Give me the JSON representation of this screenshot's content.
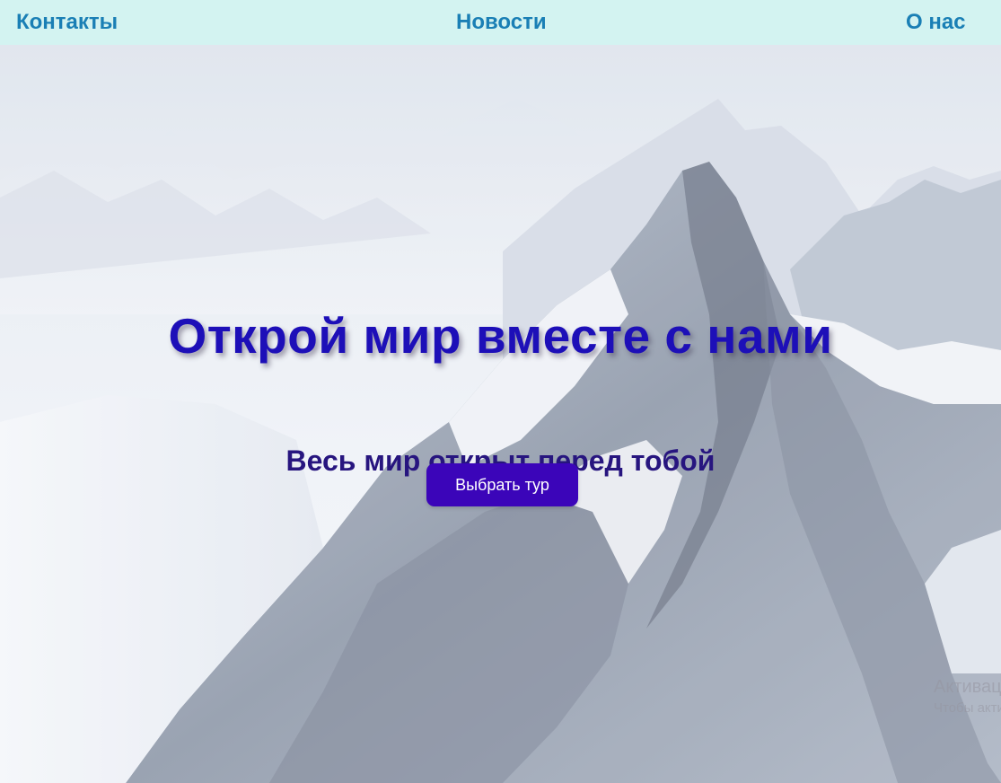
{
  "nav": {
    "links": [
      {
        "label": "Контакты"
      },
      {
        "label": "Новости"
      },
      {
        "label": "О нас"
      }
    ],
    "background": "#d3f3f1",
    "link_color": "#1a7fb5"
  },
  "hero": {
    "background_image": "snowy-mountain-peaks",
    "title": "Открой мир вместе с нами",
    "subtitle": "Весь мир открыт перед тобой",
    "cta_label": "Выбрать тур",
    "title_color": "#1d0fb8",
    "subtitle_color": "#27157f",
    "cta_color": "#3b05b9"
  },
  "watermark": {
    "line1": "Активация",
    "line2": "Чтобы активировать"
  }
}
